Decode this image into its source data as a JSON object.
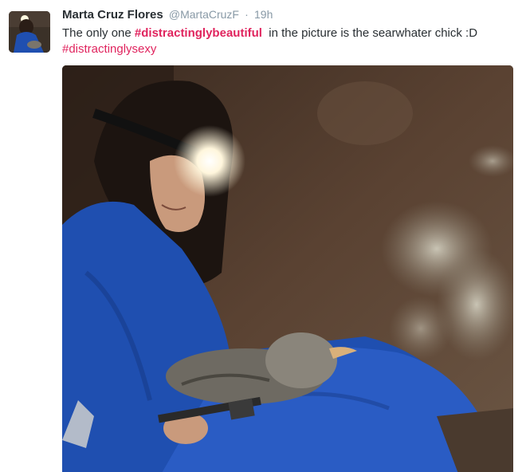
{
  "tweet": {
    "display_name": "Marta Cruz Flores",
    "screen_name": "@MartaCruzF",
    "separator": "·",
    "time": "19h",
    "text_part1": "The only one ",
    "hashtag1": "#distractinglybeautiful",
    "text_part2": "  in the picture is the searwhater chick :D",
    "hashtag2": "#distractinglysexy"
  },
  "colors": {
    "hashtag": "#e0245e",
    "name": "#292f33",
    "meta": "#8899a6",
    "jumpsuit": "#1f4fb0"
  },
  "media": {
    "description_icon": "photo"
  }
}
